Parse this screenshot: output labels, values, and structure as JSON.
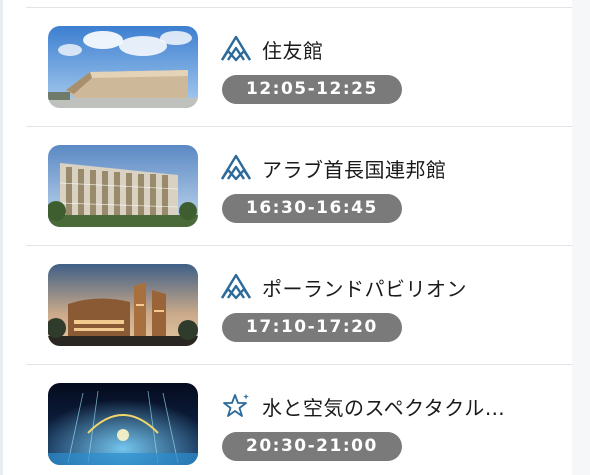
{
  "colors": {
    "pavilion_icon": "#2b6a9a",
    "show_icon": "#2b6a9a",
    "time_badge_bg": "#7a7a7a",
    "time_badge_text": "#ffffff",
    "divider": "#e1e4e8"
  },
  "items": [
    {
      "icon": "pavilion-icon",
      "title": "住友館",
      "time": "12:05-12:25",
      "image": "sumitomo-pavilion-photo"
    },
    {
      "icon": "pavilion-icon",
      "title": "アラブ首長国連邦館",
      "time": "16:30-16:45",
      "image": "uae-pavilion-photo"
    },
    {
      "icon": "pavilion-icon",
      "title": "ポーランドパビリオン",
      "time": "17:10-17:20",
      "image": "poland-pavilion-photo"
    },
    {
      "icon": "event-star-icon",
      "title": "水と空気のスペクタクル…",
      "time": "20:30-21:00",
      "image": "night-show-photo"
    }
  ]
}
